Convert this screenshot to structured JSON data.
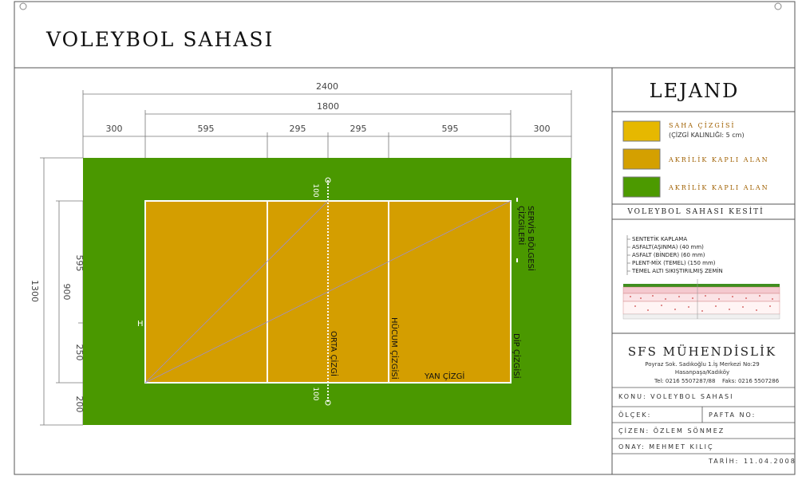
{
  "title": "VOLEYBOL SAHASI",
  "dimensions": {
    "total_width": "2400",
    "court_length": "1800",
    "segments": [
      "300",
      "595",
      "295",
      "295",
      "595",
      "300"
    ],
    "total_height": "1300",
    "inner_height": "900",
    "left_segments": [
      "595",
      "250",
      "200"
    ],
    "antenna_top": "100",
    "antenna_bottom": "100",
    "post_label": "H"
  },
  "court_labels": {
    "service_zone_line1": "SERVİS BÖLGESİ",
    "service_zone_line2": "ÇİZGİLERİ",
    "center_line": "ORTA ÇİZGİ",
    "attack_line": "HÜCUM ÇİZGİSİ",
    "side_line": "YAN ÇİZGİ",
    "end_line": "DİP ÇİZGİSİ"
  },
  "legend": {
    "title": "LEJAND",
    "items": [
      {
        "label_line1": "SAHA ÇİZGİSİ",
        "label_line2": "(ÇİZGİ KALINLIĞI: 5 cm)",
        "color": "#e6b800"
      },
      {
        "label_line1": "AKRİLİK KAPLI ALAN",
        "label_line2": "",
        "color": "#d4a000"
      },
      {
        "label_line1": "AKRİLİK KAPLI ALAN",
        "label_line2": "",
        "color": "#4c9a00"
      }
    ]
  },
  "section": {
    "title": "VOLEYBOL SAHASI KESİTİ",
    "layers": [
      "SENTETİK KAPLAMA",
      "ASFALT(AŞINMA) (40 mm)",
      "ASFALT (BİNDER) (60 mm)",
      "PLENT-MİX (TEMEL) (150 mm)",
      "TEMEL ALTI SIKIŞTIRILMIŞ ZEMİN"
    ]
  },
  "company": {
    "name": "SFS MÜHENDİSLİK",
    "address1": "Poyraz Sok. Sadıkoğlu 1.İş Merkezi No:29",
    "address2": "Hasanpaşa/Kadıköy",
    "tel": "Tel: 0216 5507287/88",
    "fax": "Faks: 0216 5507286"
  },
  "title_block": {
    "konu": "KONU: VOLEYBOL SAHASI",
    "olcek": "ÖLÇEK:",
    "pafta": "PAFTA NO:",
    "cizen": "ÇİZEN: ÖZLEM SÖNMEZ",
    "onay": "ONAY: MEHMET KILIÇ",
    "tarih": "TARİH:",
    "tarih_value": "11.04.2008"
  },
  "colors": {
    "green_surface": "#4a9800",
    "court_orange": "#d49e00",
    "line_white": "#ffffff"
  }
}
